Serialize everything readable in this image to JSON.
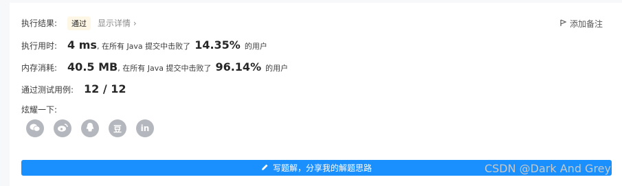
{
  "result": {
    "label": "执行结果:",
    "status": "通过",
    "detail": "显示详情 ›"
  },
  "add_note": "添加备注",
  "runtime": {
    "label": "执行用时:",
    "value": "4 ms",
    "text_prefix": ", 在所有 Java 提交中击败了",
    "percent": "14.35%",
    "text_suffix": "的用户"
  },
  "memory": {
    "label": "内存消耗:",
    "value": "40.5 MB",
    "text_prefix": ", 在所有 Java 提交中击败了",
    "percent": "96.14%",
    "text_suffix": "的用户"
  },
  "tests": {
    "label": "通过测试用例:",
    "value": "12 / 12"
  },
  "share": {
    "label": "炫耀一下:",
    "icons": [
      "wechat-icon",
      "weibo-icon",
      "qq-icon",
      "douban-icon",
      "linkedin-icon"
    ],
    "douban_glyph": "豆",
    "linkedin_glyph": "in"
  },
  "write_solution_button": "写题解，分享我的解题思路",
  "watermark": "CSDN @Dark And Grey",
  "colors": {
    "accent": "#1a90ff",
    "badge_bg": "#fff7e6",
    "share_icon_bg": "#b4b7bd"
  }
}
